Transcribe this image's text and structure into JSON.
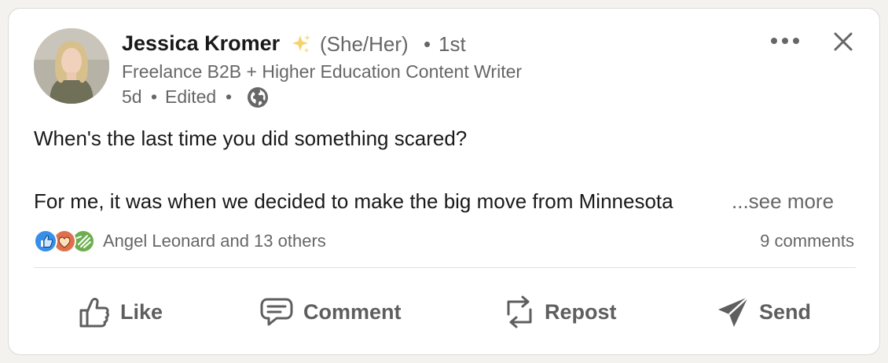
{
  "post": {
    "author": {
      "name": "Jessica Kromer",
      "badge_icon": "sparkle-icon",
      "pronouns": "(She/Her)",
      "degree_separator": "•",
      "degree": "1st",
      "headline": "Freelance B2B + Higher Education Content Writer"
    },
    "meta": {
      "time": "5d",
      "separator": "•",
      "edited": "Edited",
      "visibility_icon": "globe-icon"
    },
    "body": {
      "line1": "When's the last time you did something scared?",
      "line2": "For me, it was when we decided to make the big move from Minnesota",
      "see_more": "...see more"
    },
    "social": {
      "reaction_icons": [
        "like-reaction-icon",
        "love-reaction-icon",
        "celebrate-reaction-icon"
      ],
      "reactions_text": "Angel Leonard and 13 others",
      "comments_text": "9 comments"
    },
    "actions": [
      {
        "label": "Like",
        "icon": "thumbs-up-icon"
      },
      {
        "label": "Comment",
        "icon": "comment-icon"
      },
      {
        "label": "Repost",
        "icon": "repost-icon"
      },
      {
        "label": "Send",
        "icon": "send-icon"
      }
    ],
    "controls": {
      "more_icon": "ellipsis-icon",
      "close_icon": "close-icon"
    },
    "colors": {
      "like_blue": "#378fe9",
      "love_red": "#df704d",
      "celebrate_green": "#6dae4f",
      "text_secondary": "#666666"
    }
  }
}
